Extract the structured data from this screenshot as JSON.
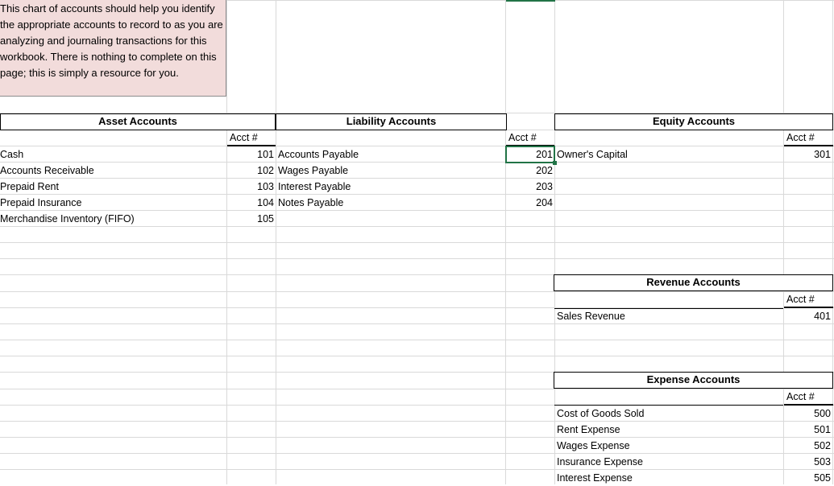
{
  "note": "This chart of accounts should help you identify the appropriate accounts to record to as you are analyzing and journaling transactions for this workbook. There is nothing to complete on this page; this is simply a resource for you.",
  "asset": {
    "title": "Asset Accounts",
    "acct_label": "Acct #",
    "rows": [
      {
        "name": "Cash",
        "num": "101"
      },
      {
        "name": "Accounts Receivable",
        "num": "102"
      },
      {
        "name": "Prepaid Rent",
        "num": "103"
      },
      {
        "name": "Prepaid Insurance",
        "num": "104"
      },
      {
        "name": "Merchandise Inventory (FIFO)",
        "num": "105"
      }
    ]
  },
  "liability": {
    "title": "Liability Accounts",
    "acct_label": "Acct #",
    "rows": [
      {
        "name": "Accounts Payable",
        "num": "201"
      },
      {
        "name": "Wages Payable",
        "num": "202"
      },
      {
        "name": "Interest Payable",
        "num": "203"
      },
      {
        "name": "Notes Payable",
        "num": "204"
      }
    ]
  },
  "equity": {
    "title": "Equity Accounts",
    "acct_label": "Acct #",
    "rows": [
      {
        "name": "Owner's Capital",
        "num": "301"
      }
    ]
  },
  "revenue": {
    "title": "Revenue Accounts",
    "acct_label": "Acct #",
    "rows": [
      {
        "name": "Sales Revenue",
        "num": "401"
      }
    ]
  },
  "expense": {
    "title": "Expense Accounts",
    "acct_label": "Acct #",
    "rows": [
      {
        "name": "Cost of Goods Sold",
        "num": "500"
      },
      {
        "name": "Rent Expense",
        "num": "501"
      },
      {
        "name": "Wages Expense",
        "num": "502"
      },
      {
        "name": "Insurance Expense",
        "num": "503"
      },
      {
        "name": "Interest Expense",
        "num": "505"
      }
    ]
  }
}
